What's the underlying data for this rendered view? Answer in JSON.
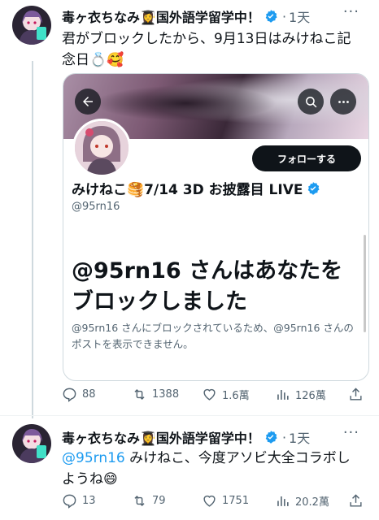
{
  "tweet1": {
    "author_name": "毒ヶ衣ちなみ👩‍🎓国外語学留学中！",
    "time": "1天",
    "text": "君がブロックしたから、9月13日はみけねこ記念日💍🥰",
    "replies": "88",
    "retweets": "1388",
    "likes": "1.6萬",
    "views": "126萬"
  },
  "card": {
    "follow_label": "フォローする",
    "profile_name": "みけねこ🥞7/14 3D お披露目 LIVE",
    "handle": "@95rn16",
    "blocked_title": "@95rn16 さんはあなたをブロックしました",
    "blocked_body": "@95rn16 さんにブロックされているため、@95rn16 さんのポストを表示できません。"
  },
  "tweet2": {
    "author_name": "毒ヶ衣ちなみ👩‍🎓国外語学留学中！",
    "time": "1天",
    "mention": "@95rn16",
    "text_rest": " みけねこ、今度アソビ大全コラボしようね😄",
    "replies": "13",
    "retweets": "79",
    "likes": "1751",
    "views": "20.2萬"
  },
  "colors": {
    "accent": "#1d9bf0",
    "text": "#0f1419",
    "muted": "#536471",
    "border": "#cfd9de"
  },
  "icons": [
    "avatar",
    "verified-badge",
    "more-icon",
    "back-arrow-icon",
    "search-icon",
    "menu-icon",
    "reply-icon",
    "retweet-icon",
    "like-icon",
    "views-icon",
    "share-icon"
  ]
}
